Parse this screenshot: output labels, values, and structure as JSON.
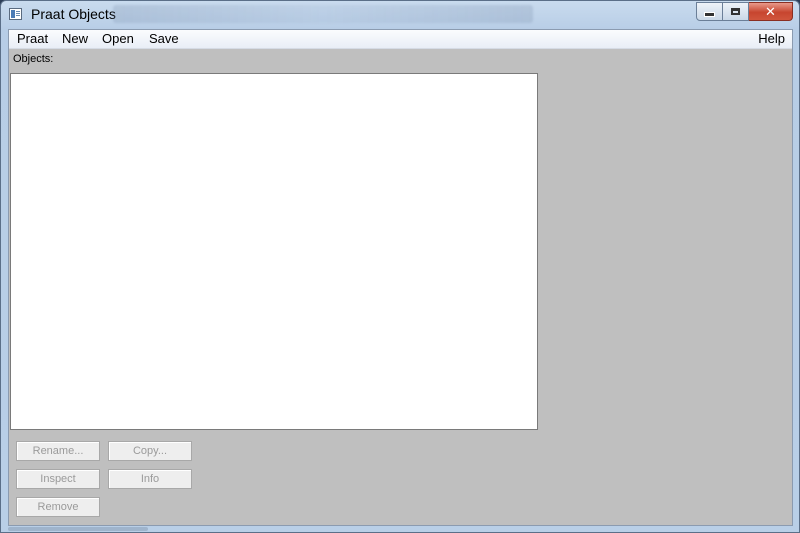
{
  "window": {
    "title": "Praat Objects",
    "close_glyph": "✕"
  },
  "menubar": {
    "items": [
      "Praat",
      "New",
      "Open",
      "Save"
    ],
    "help": "Help"
  },
  "objects": {
    "label": "Objects:"
  },
  "buttons": {
    "rename": "Rename...",
    "copy": "Copy...",
    "inspect": "Inspect",
    "info": "Info",
    "remove": "Remove"
  },
  "icons": {
    "app": "praat-app-icon",
    "minimize": "minimize-icon",
    "maximize": "maximize-icon",
    "close": "close-icon"
  },
  "colors": {
    "client_background": "#bfbfbf",
    "list_background": "#ffffff",
    "disabled_text": "#9a9a9a",
    "close_button": "#c7452f"
  }
}
